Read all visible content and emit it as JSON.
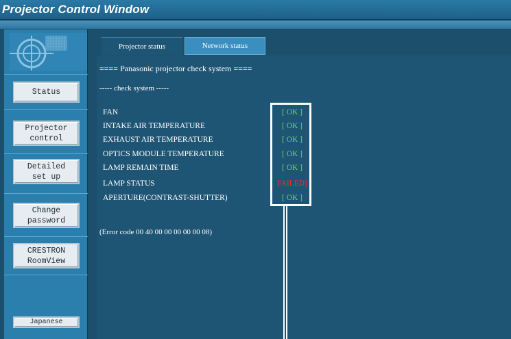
{
  "window": {
    "title": "Projector Control Window"
  },
  "sidebar": {
    "logo_icon": "projector-lens-logo",
    "items": [
      {
        "id": "status",
        "label": "Status"
      },
      {
        "id": "projector-control",
        "label": "Projector\ncontrol"
      },
      {
        "id": "detailed-setup",
        "label": "Detailed\nset up"
      },
      {
        "id": "change-password",
        "label": "Change\npassword"
      },
      {
        "id": "crestron",
        "label": "CRESTRON\nRoomView"
      }
    ],
    "language_button": "Japanese"
  },
  "tabs": [
    {
      "label": "Projector status",
      "active": true
    },
    {
      "label": "Network status",
      "active": false
    }
  ],
  "content": {
    "header": "==== Panasonic projector check system ====",
    "subheader": "----- check system -----",
    "checks": [
      {
        "label": "FAN",
        "status": "[ OK ]",
        "state": "ok"
      },
      {
        "label": "INTAKE AIR TEMPERATURE",
        "status": "[ OK ]",
        "state": "ok"
      },
      {
        "label": "EXHAUST AIR TEMPERATURE",
        "status": "[ OK ]",
        "state": "ok"
      },
      {
        "label": "OPTICS MODULE TEMPERATURE",
        "status": "[ OK ]",
        "state": "ok"
      },
      {
        "label": "LAMP REMAIN TIME",
        "status": "[ OK ]",
        "state": "ok"
      },
      {
        "label": "LAMP STATUS",
        "status": "FAILED]",
        "state": "failed"
      },
      {
        "label": "APERTURE(CONTRAST-SHUTTER)",
        "status": "[ OK ]",
        "state": "ok"
      }
    ],
    "error_code": "(Error code 00 40 00 00 00 00 00 08)"
  },
  "colors": {
    "ok": "#6dd36a",
    "failed": "#ff2a2a",
    "panel": "#1f5574"
  }
}
